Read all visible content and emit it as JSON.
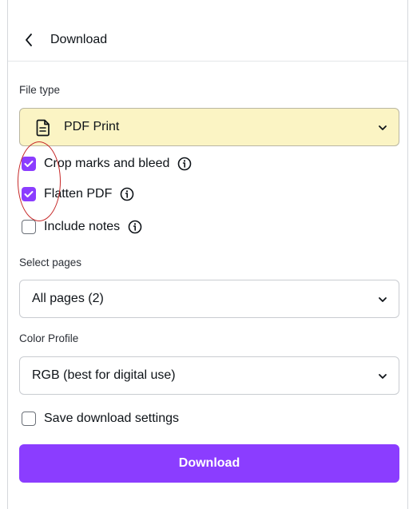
{
  "header": {
    "title": "Download",
    "back_icon": "chevron-left-icon"
  },
  "file_type": {
    "label": "File type",
    "selected": "PDF Print",
    "icon": "document-icon",
    "highlight_color": "#fbf4c4"
  },
  "options": [
    {
      "label": "Crop marks and bleed",
      "checked": true,
      "info_icon": "info-icon"
    },
    {
      "label": "Flatten PDF",
      "checked": true,
      "info_icon": "info-icon"
    },
    {
      "label": "Include notes",
      "checked": false,
      "info_icon": "info-icon"
    }
  ],
  "select_pages": {
    "label": "Select pages",
    "selected": "All pages (2)"
  },
  "color_profile": {
    "label": "Color Profile",
    "selected": "RGB (best for digital use)"
  },
  "save_settings": {
    "label": "Save download settings",
    "checked": false
  },
  "download_button": {
    "label": "Download",
    "color": "#8b3dff"
  },
  "annotation": {
    "shape": "ellipse",
    "color": "#c62828"
  }
}
